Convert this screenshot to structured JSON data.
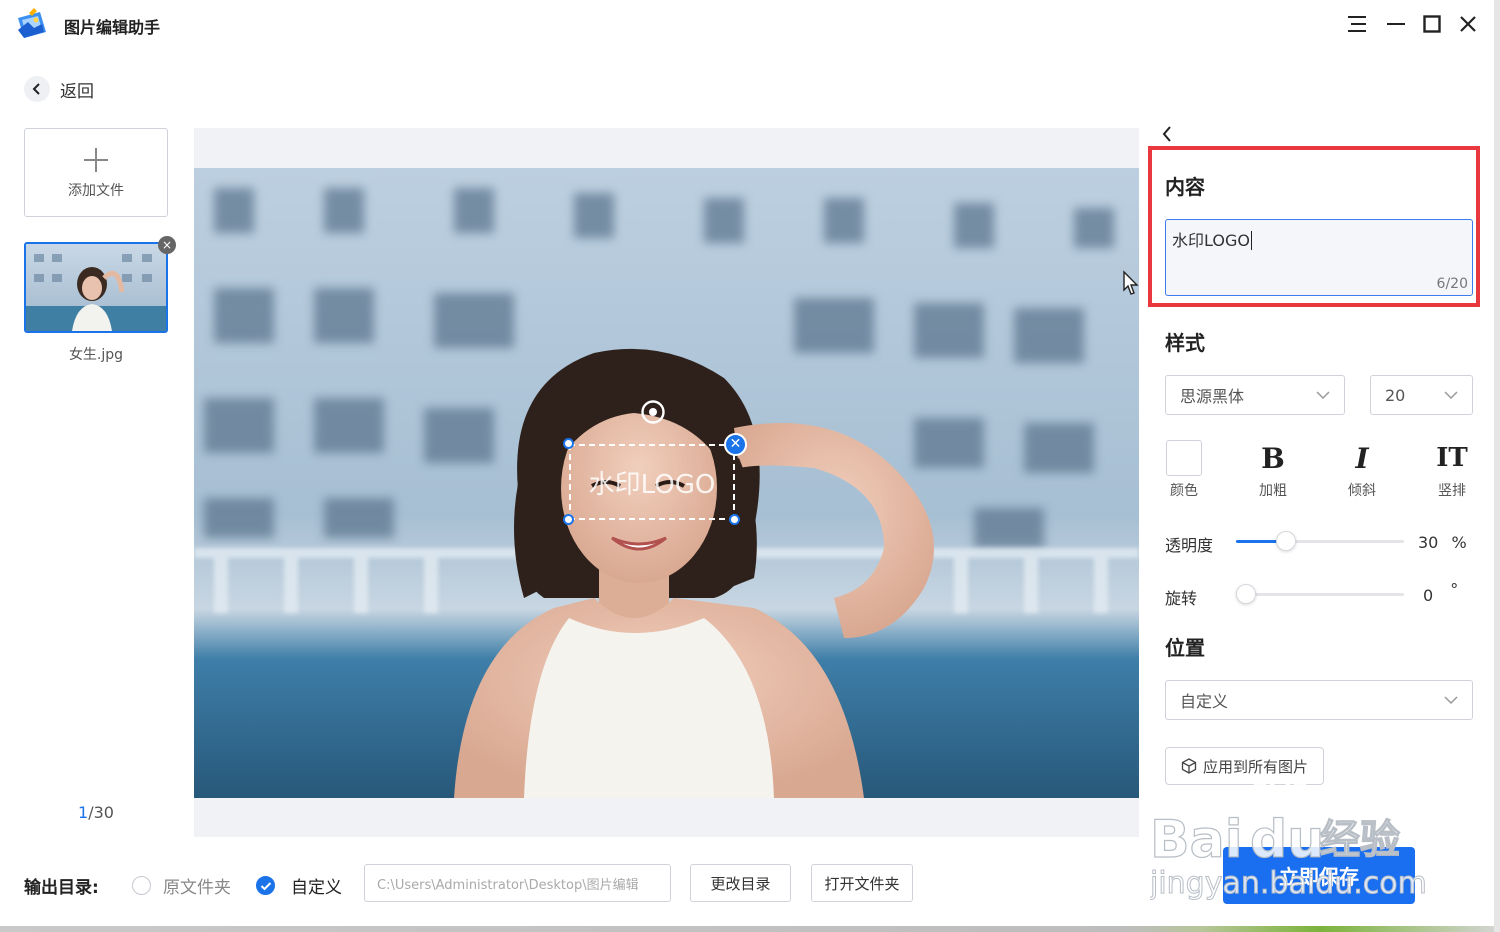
{
  "app": {
    "title": "图片编辑助手"
  },
  "nav": {
    "back_label": "返回"
  },
  "sidebar": {
    "add_file_label": "添加文件",
    "files": [
      {
        "name": "女生.jpg",
        "selected": true
      }
    ],
    "page_current": "1",
    "page_total": "/30"
  },
  "watermark": {
    "text": "水印LOGO"
  },
  "panel": {
    "content_title": "内容",
    "content_value": "水印LOGO",
    "content_count": "6/20",
    "style_title": "样式",
    "font_family": "思源黑体",
    "font_size": "20",
    "tools": [
      {
        "label": "颜色"
      },
      {
        "label": "加粗",
        "glyph": "B"
      },
      {
        "label": "倾斜",
        "glyph": "I"
      },
      {
        "label": "竖排",
        "glyph": "IT"
      }
    ],
    "opacity_label": "透明度",
    "opacity_value": "30",
    "opacity_unit": "%",
    "opacity_fraction": 0.3,
    "rotate_label": "旋转",
    "rotate_value": "0",
    "rotate_unit": "°",
    "rotate_fraction": 0,
    "position_title": "位置",
    "position_value": "自定义",
    "apply_all_label": "应用到所有图片",
    "save_label": "立即保存"
  },
  "output": {
    "label": "输出目录:",
    "option_original": "原文件夹",
    "option_custom": "自定义",
    "selected": "custom",
    "path": "C:\\Users\\Administrator\\Desktop\\图片编辑",
    "change_dir_label": "更改目录",
    "open_folder_label": "打开文件夹"
  },
  "overlay_watermark": {
    "line1": "Bai",
    "line1b": "du",
    "line1c": "经验",
    "line2": "jingyan.baidu.com"
  },
  "colors": {
    "accent": "#1a73e8",
    "highlight": "#e8383d",
    "save": "#1a6ff0"
  }
}
